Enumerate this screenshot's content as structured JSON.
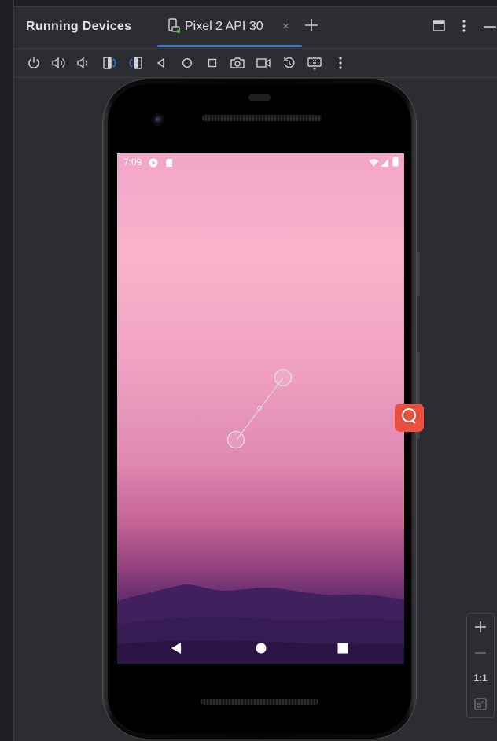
{
  "window": {
    "tool_window_title": "Running Devices",
    "active_tab": {
      "label": "Pixel 2 API 30",
      "close_symbol": "×"
    }
  },
  "toolbar": {
    "icons": [
      "power-icon",
      "volume-up-icon",
      "volume-down-icon",
      "rotate-left-icon",
      "rotate-right-icon",
      "back-icon",
      "home-icon",
      "overview-icon",
      "screenshot-icon",
      "screen-record-icon",
      "reset-icon",
      "keyboard-icon",
      "more-options-icon"
    ]
  },
  "device": {
    "status_bar": {
      "time": "7:09"
    },
    "gesture_overlay": {
      "type": "pinch-zoom"
    }
  },
  "zoom_controls": {
    "actual_size_label": "1:1"
  },
  "colors": {
    "accent": "#3574f0",
    "fab": "#e8503f",
    "background": "#2b2d30"
  }
}
